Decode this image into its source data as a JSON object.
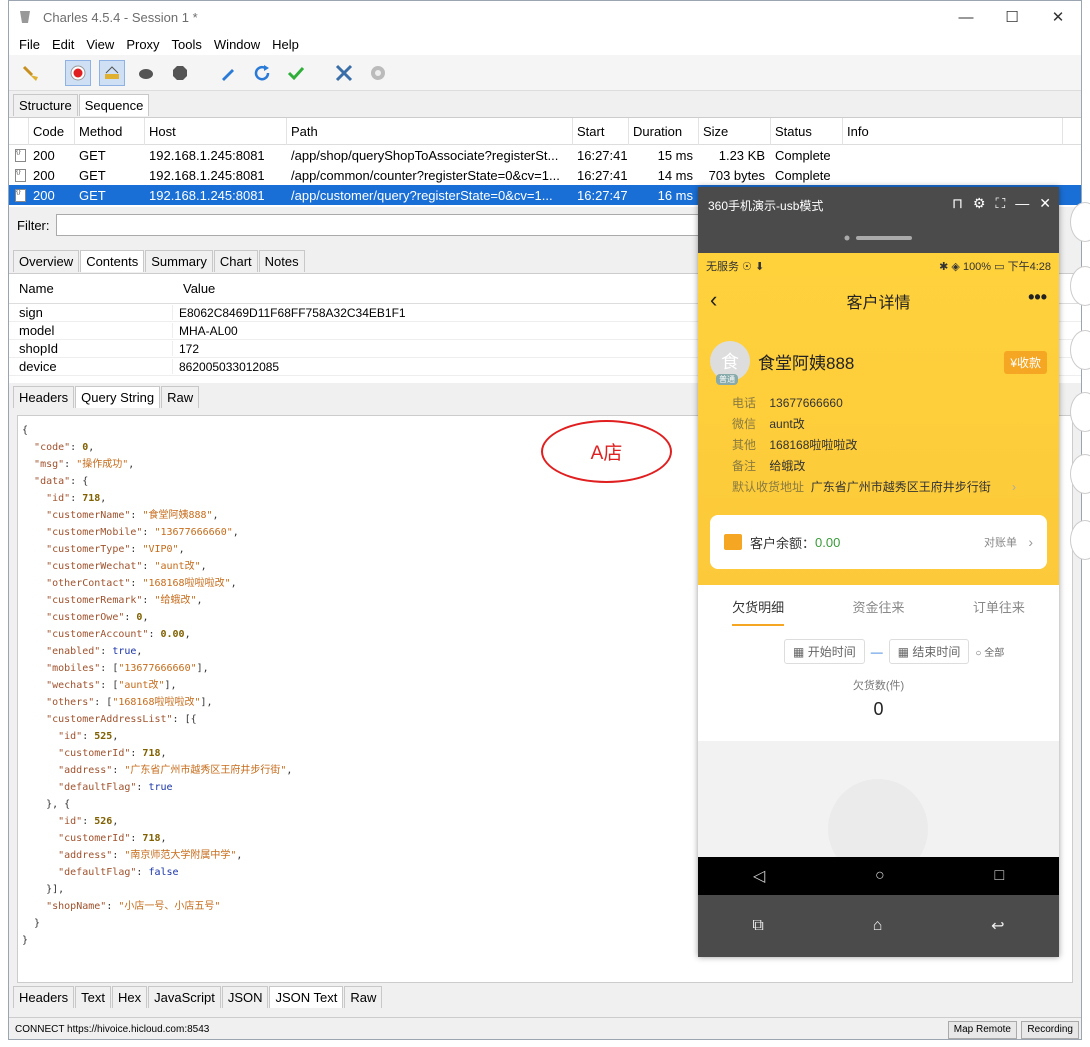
{
  "window": {
    "title": "Charles 4.5.4 - Session 1 *"
  },
  "menu": [
    "File",
    "Edit",
    "View",
    "Proxy",
    "Tools",
    "Window",
    "Help"
  ],
  "top_tabs": [
    "Structure",
    "Sequence"
  ],
  "sequence": {
    "columns": [
      "Code",
      "Method",
      "Host",
      "Path",
      "Start",
      "Duration",
      "Size",
      "Status",
      "Info"
    ],
    "rows": [
      {
        "code": "200",
        "method": "GET",
        "host": "192.168.1.245:8081",
        "path": "/app/shop/queryShopToAssociate?registerSt...",
        "start": "16:27:41",
        "duration": "15 ms",
        "size": "1.23 KB",
        "status": "Complete"
      },
      {
        "code": "200",
        "method": "GET",
        "host": "192.168.1.245:8081",
        "path": "/app/common/counter?registerState=0&cv=1...",
        "start": "16:27:41",
        "duration": "14 ms",
        "size": "703 bytes",
        "status": "Complete"
      },
      {
        "code": "200",
        "method": "GET",
        "host": "192.168.1.245:8081",
        "path": "/app/customer/query?registerState=0&cv=1...",
        "start": "16:27:47",
        "duration": "16 ms",
        "size": "",
        "status": ""
      }
    ]
  },
  "filter_label": "Filter:",
  "content_tabs": [
    "Overview",
    "Contents",
    "Summary",
    "Chart",
    "Notes"
  ],
  "kv": {
    "head_name": "Name",
    "head_value": "Value",
    "rows": [
      {
        "name": "sign",
        "value": "E8062C8469D11F68FF758A32C34EB1F1"
      },
      {
        "name": "model",
        "value": "MHA-AL00"
      },
      {
        "name": "shopId",
        "value": "172"
      },
      {
        "name": "device",
        "value": "862005033012085"
      }
    ]
  },
  "query_tabs": [
    "Headers",
    "Query String",
    "Raw"
  ],
  "annotation": "A店",
  "bottom_tabs": [
    "Headers",
    "Text",
    "Hex",
    "JavaScript",
    "JSON",
    "JSON Text",
    "Raw"
  ],
  "status": {
    "connect": "CONNECT https://hivoice.hicloud.com:8543",
    "map_remote": "Map Remote",
    "recording": "Recording"
  },
  "phone": {
    "window_title": "360手机演示-usb模式",
    "status_left": "无服务 ☉ ⬇",
    "status_right": "✱ ◈ 100% ▭ 下午4:28",
    "page_title": "客户详情",
    "avatar_char": "食",
    "avatar_tag": "普通",
    "customer_name": "食堂阿姨888",
    "collect": "¥收款",
    "info": [
      {
        "label": "电话",
        "value": "13677666660"
      },
      {
        "label": "微信",
        "value": "aunt改"
      },
      {
        "label": "其他",
        "value": "168168啦啦啦改"
      },
      {
        "label": "备注",
        "value": "给蛾改"
      }
    ],
    "address_label": "默认收货地址",
    "address_value": "广东省广州市越秀区王府井步行街",
    "balance_label": "客户余额：",
    "balance_value": "0.00",
    "balance_link": "对账单",
    "tabs": [
      "欠货明细",
      "资金往来",
      "订单往来"
    ],
    "start_time": "开始时间",
    "end_time": "结束时间",
    "all": "全部",
    "owe_label": "欠货数(件)",
    "owe_value": "0"
  }
}
